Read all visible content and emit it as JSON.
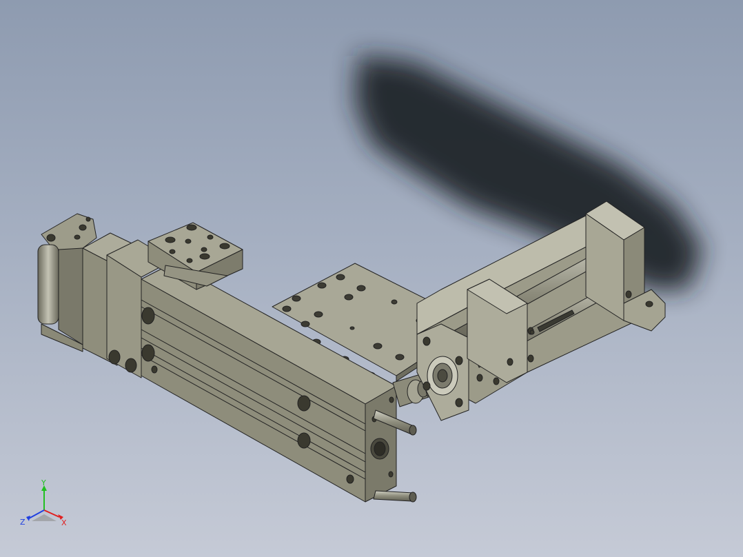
{
  "viewport": {
    "background_top": "#8e9bb0",
    "background_bottom": "#c5cad6",
    "model_color": "#a09f8c",
    "edge_color": "#222222"
  },
  "triad": {
    "x_label": "X",
    "y_label": "Y",
    "z_label": "Z",
    "x_color": "#e02020",
    "y_color": "#20c020",
    "z_color": "#2040e0"
  }
}
